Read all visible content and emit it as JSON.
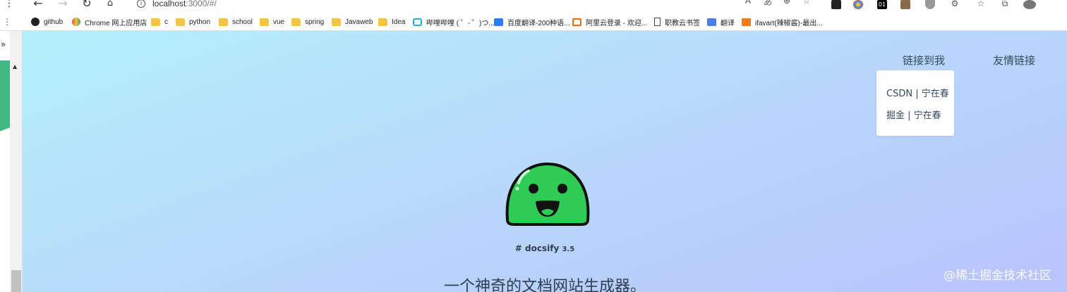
{
  "browser": {
    "url_host": "localhost",
    "url_rest": ":3000/#/",
    "back_icon": "arrow-left",
    "forward_icon": "arrow-right",
    "reload_icon": "reload",
    "home_icon": "home",
    "sidebar_toggle": "»"
  },
  "bookmarks": [
    {
      "label": "github",
      "icon": "github-icon"
    },
    {
      "label": "Chrome 网上应用店",
      "icon": "chrome-store-icon"
    },
    {
      "label": "c",
      "icon": "folder-icon"
    },
    {
      "label": "python",
      "icon": "folder-icon"
    },
    {
      "label": "school",
      "icon": "folder-icon"
    },
    {
      "label": "vue",
      "icon": "folder-icon"
    },
    {
      "label": "spring",
      "icon": "folder-icon"
    },
    {
      "label": "Javaweb",
      "icon": "folder-icon"
    },
    {
      "label": "Idea",
      "icon": "folder-icon"
    },
    {
      "label": "哔哩哔哩 ( ゜- ゜)つ...",
      "icon": "bilibili-icon"
    },
    {
      "label": "百度翻译-200种语...",
      "icon": "baidu-translate-icon"
    },
    {
      "label": "阿里云登录 - 欢迎...",
      "icon": "aliyun-icon"
    },
    {
      "label": "职教云书签",
      "icon": "page-icon"
    },
    {
      "label": "翻译",
      "icon": "translate-icon"
    },
    {
      "label": "ifavart(辣椒酱)-最出...",
      "icon": "ifavart-icon"
    }
  ],
  "site": {
    "nav": [
      {
        "label": "链接到我"
      },
      {
        "label": "友情链接"
      }
    ],
    "dropdown": [
      {
        "label": "CSDN | 宁在春"
      },
      {
        "label": "掘金 | 宁在春"
      }
    ],
    "cover": {
      "title_prefix": "# docsify",
      "version": "3.5",
      "subtitle": "一个神奇的文档网站生成器。"
    },
    "watermark": "@稀土掘金技术社区"
  },
  "colors": {
    "accent": "#42b983",
    "text": "#34495e",
    "mascot": "#2fcc55"
  }
}
